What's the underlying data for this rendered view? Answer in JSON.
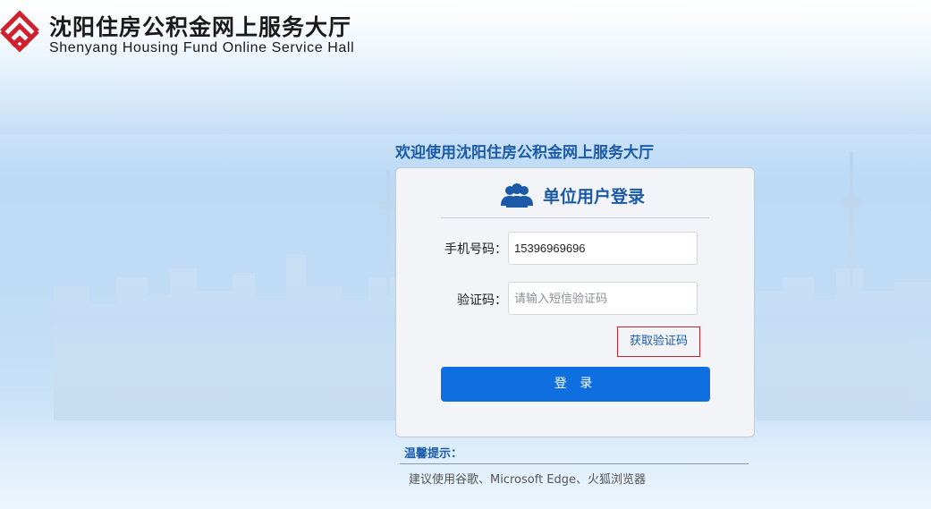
{
  "header": {
    "title_cn": "沈阳住房公积金网上服务大厅",
    "title_en": "Shenyang Housing Fund Online Service Hall",
    "logo_icon": "shenyang-housing-fund-logo",
    "brand_color": "#d0202c"
  },
  "welcome": "欢迎使用沈阳住房公积金网上服务大厅",
  "login": {
    "icon": "users-icon",
    "title": "单位用户登录",
    "phone_label": "手机号码：",
    "phone_value": "15396969696",
    "code_label": "验证码：",
    "code_placeholder": "请输入短信验证码",
    "get_code_label": "获取验证码",
    "submit_label": "登 录",
    "accent": "#0f6fe0",
    "title_color": "#1a5aa6"
  },
  "tips": {
    "title": "温馨提示：",
    "text": "建议使用谷歌、Microsoft Edge、火狐浏览器"
  }
}
